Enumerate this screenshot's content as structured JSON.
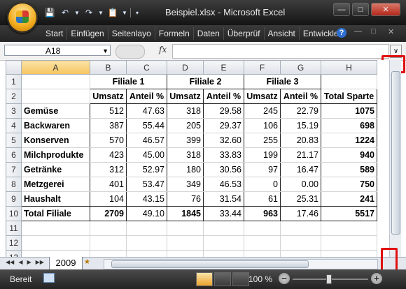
{
  "window": {
    "title": "Beispiel.xlsx - Microsoft Excel"
  },
  "ribbon_tabs": [
    "Start",
    "Einfügen",
    "Seitenlayo",
    "Formeln",
    "Daten",
    "Überprüf",
    "Ansicht",
    "Entwickle"
  ],
  "formula_bar": {
    "name_box": "A18",
    "fx": "fx",
    "content": ""
  },
  "columns": [
    "A",
    "B",
    "C",
    "D",
    "E",
    "F",
    "G",
    "H"
  ],
  "rows": [
    "1",
    "2",
    "3",
    "4",
    "5",
    "6",
    "7",
    "8",
    "9",
    "10",
    "11",
    "12",
    "13"
  ],
  "table": {
    "groups": [
      "Filiale 1",
      "Filiale 2",
      "Filiale 3"
    ],
    "subheaders": [
      "Umsatz",
      "Anteil %",
      "Umsatz",
      "Anteil %",
      "Umsatz",
      "Anteil %",
      "Total Sparte"
    ],
    "data": [
      [
        "Gemüse",
        "512",
        "47.63",
        "318",
        "29.58",
        "245",
        "22.79",
        "1075"
      ],
      [
        "Backwaren",
        "387",
        "55.44",
        "205",
        "29.37",
        "106",
        "15.19",
        "698"
      ],
      [
        "Konserven",
        "570",
        "46.57",
        "399",
        "32.60",
        "255",
        "20.83",
        "1224"
      ],
      [
        "Milchprodukte",
        "423",
        "45.00",
        "318",
        "33.83",
        "199",
        "21.17",
        "940"
      ],
      [
        "Getränke",
        "312",
        "52.97",
        "180",
        "30.56",
        "97",
        "16.47",
        "589"
      ],
      [
        "Metzgerei",
        "401",
        "53.47",
        "349",
        "46.53",
        "0",
        "0.00",
        "750"
      ],
      [
        "Haushalt",
        "104",
        "43.15",
        "76",
        "31.54",
        "61",
        "25.31",
        "241"
      ],
      [
        "Total Filiale",
        "2709",
        "49.10",
        "1845",
        "33.44",
        "963",
        "17.46",
        "5517"
      ]
    ]
  },
  "sheet_tabs": [
    "2009"
  ],
  "status": {
    "text": "Bereit",
    "zoom": "100 %"
  }
}
